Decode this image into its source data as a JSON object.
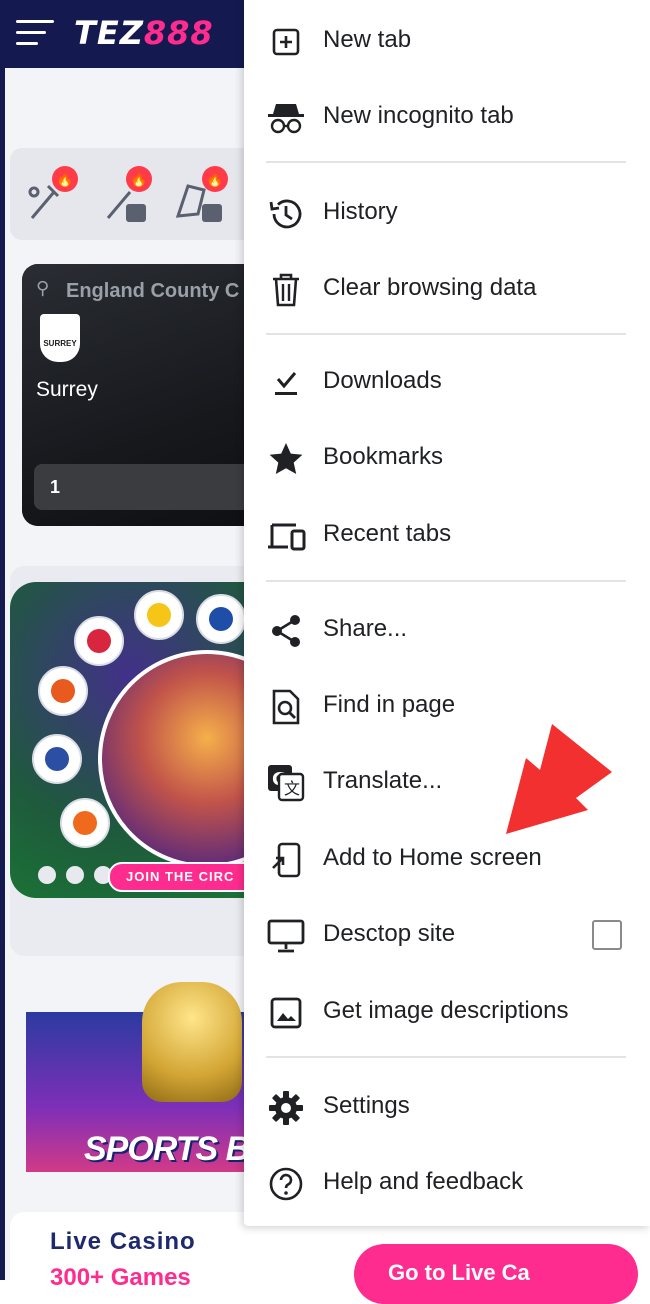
{
  "site": {
    "logo_white": "TEZ",
    "logo_pink": "888",
    "match": {
      "league": "England County C",
      "team": "Surrey",
      "crest_text": "SURREY",
      "odds_label": "1"
    },
    "banner_join_text": "JOIN THE CIRC",
    "sports_text": "SPORTS BOO",
    "casino": {
      "title": "Live Casino",
      "count": "300+ Games",
      "button": "Go to Live Ca"
    },
    "colors": {
      "header": "#141a4f",
      "accent": "#ff2c8f"
    }
  },
  "menu": {
    "items": [
      {
        "label": "New tab",
        "icon": "add-box-icon"
      },
      {
        "label": "New incognito tab",
        "icon": "incognito-icon"
      },
      {
        "label": "History",
        "icon": "history-icon"
      },
      {
        "label": "Clear browsing data",
        "icon": "trash-icon"
      },
      {
        "label": "Downloads",
        "icon": "download-icon"
      },
      {
        "label": "Bookmarks",
        "icon": "star-icon"
      },
      {
        "label": "Recent tabs",
        "icon": "devices-icon"
      },
      {
        "label": "Share...",
        "icon": "share-icon"
      },
      {
        "label": "Find in page",
        "icon": "find-in-page-icon"
      },
      {
        "label": "Translate...",
        "icon": "translate-icon"
      },
      {
        "label": "Add to Home screen",
        "icon": "add-to-home-icon"
      },
      {
        "label": "Desctop site",
        "icon": "desktop-icon",
        "checked": false
      },
      {
        "label": "Get image descriptions",
        "icon": "image-icon"
      },
      {
        "label": "Settings",
        "icon": "gear-icon"
      },
      {
        "label": "Help and feedback",
        "icon": "help-icon"
      }
    ]
  },
  "annotation": {
    "arrow_color": "#f23030"
  }
}
